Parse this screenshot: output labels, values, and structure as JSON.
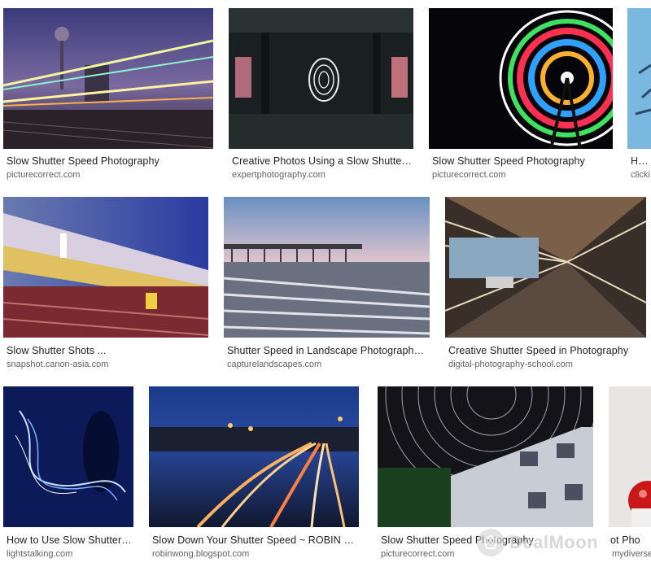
{
  "results": [
    {
      "title": "Slow Shutter Speed Photography",
      "source": "picturecorrect.com"
    },
    {
      "title": "Creative Photos Using a Slow Shutter ...",
      "source": "expertphotography.com"
    },
    {
      "title": "Slow Shutter Speed Photography",
      "source": "picturecorrect.com"
    },
    {
      "title": "How",
      "source": "clicki"
    },
    {
      "title": "Slow Shutter Shots ...",
      "source": "snapshot.canon-asia.com"
    },
    {
      "title": "Shutter Speed in Landscape Photography ...",
      "source": "capturelandscapes.com"
    },
    {
      "title": "Creative Shutter Speed in Photography",
      "source": "digital-photography-school.com"
    },
    {
      "title": "How to Use Slow Shutter ...",
      "source": "lightstalking.com"
    },
    {
      "title": "Slow Down Your Shutter Speed ~ ROBIN WONG",
      "source": "robinwong.blogspot.com"
    },
    {
      "title": "Slow Shutter Speed Photography",
      "source": "picturecorrect.com"
    },
    {
      "title": "ot Pho",
      "source": "mydiverse"
    }
  ],
  "watermark": {
    "text": "DealMoon",
    "icon": "dealmoon-logo-icon"
  }
}
